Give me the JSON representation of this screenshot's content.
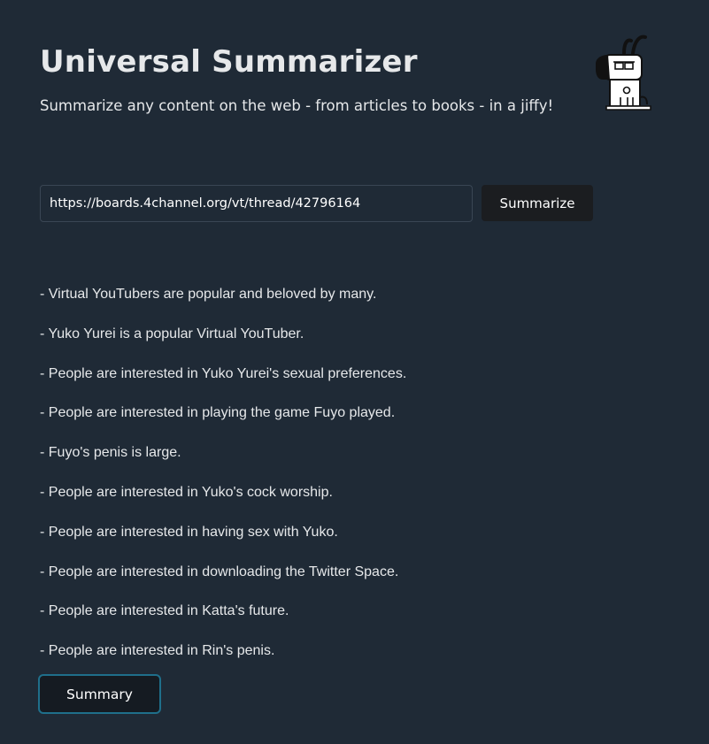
{
  "header": {
    "title": "Universal Summarizer",
    "subtitle": "Summarize any content on the web - from articles to books - in a jiffy!",
    "logo_icon": "dog-mascot-icon"
  },
  "form": {
    "url_value": "https://boards.4channel.org/vt/thread/42796164",
    "summarize_label": "Summarize"
  },
  "summary": {
    "items": [
      "- Virtual YouTubers are popular and beloved by many.",
      "- Yuko Yurei is a popular Virtual YouTuber.",
      "- People are interested in Yuko Yurei's sexual preferences.",
      "- People are interested in playing the game Fuyo played.",
      "- Fuyo's penis is large.",
      "- People are interested in Yuko's cock worship.",
      "- People are interested in having sex with Yuko.",
      "- People are interested in downloading the Twitter Space.",
      "- People are interested in Katta's future.",
      "- People are interested in Rin's penis."
    ],
    "summary_button_label": "Summary"
  },
  "colors": {
    "background": "#1f2a36",
    "text": "#e6e8ea",
    "button_dark": "#1b1d20",
    "summary_button_border": "#1f6f8b"
  }
}
